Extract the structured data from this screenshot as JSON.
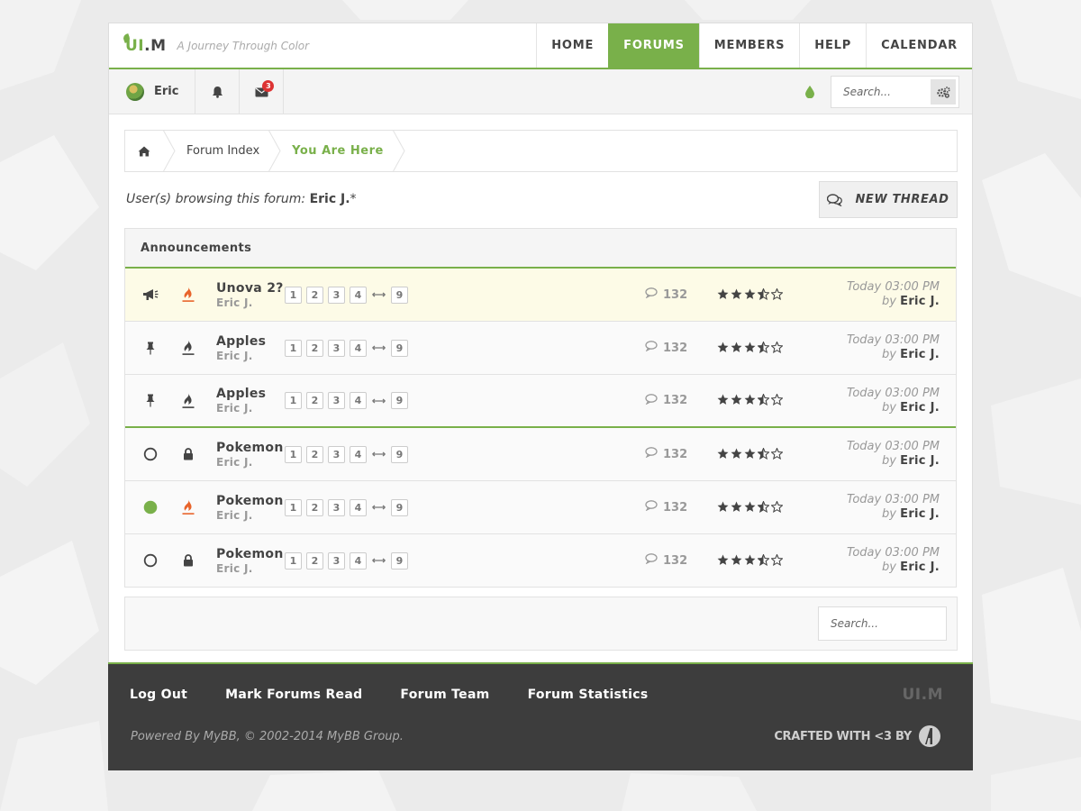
{
  "brand": {
    "logo_prefix": "UI",
    "logo_suffix": ".M",
    "tagline": "A Journey Through Color",
    "accent": "#79b04a"
  },
  "nav": [
    {
      "label": "HOME",
      "active": false
    },
    {
      "label": "FORUMS",
      "active": true
    },
    {
      "label": "MEMBERS",
      "active": false
    },
    {
      "label": "HELP",
      "active": false
    },
    {
      "label": "CALENDAR",
      "active": false
    }
  ],
  "userbar": {
    "username": "Eric",
    "message_count": "3",
    "search_placeholder": "Search..."
  },
  "breadcrumb": {
    "items": [
      "Forum Index",
      "You Are Here"
    ]
  },
  "browsing": {
    "prefix": "User(s) browsing this forum:",
    "users": "Eric J.",
    "suffix": "*"
  },
  "new_thread_label": "NEW THREAD",
  "table": {
    "header": "Announcements",
    "threads": [
      {
        "title": "Unova 2?",
        "author": "Eric J.",
        "status": "announcement-icon",
        "type": "hot-fire-icon",
        "pages": [
          "1",
          "2",
          "3",
          "4",
          "9"
        ],
        "replies": "132",
        "rating": 3.5,
        "last_time": "Today 03:00 PM",
        "last_by_prefix": "by",
        "last_by": "Eric J.",
        "highlight": true
      },
      {
        "title": "Apples",
        "author": "Eric J.",
        "status": "pin-icon",
        "type": "fire-icon",
        "pages": [
          "1",
          "2",
          "3",
          "4",
          "9"
        ],
        "replies": "132",
        "rating": 3.5,
        "last_time": "Today 03:00 PM",
        "last_by_prefix": "by",
        "last_by": "Eric J."
      },
      {
        "title": "Apples",
        "author": "Eric J.",
        "status": "pin-icon",
        "type": "fire-icon",
        "pages": [
          "1",
          "2",
          "3",
          "4",
          "9"
        ],
        "replies": "132",
        "rating": 3.5,
        "last_time": "Today 03:00 PM",
        "last_by_prefix": "by",
        "last_by": "Eric J."
      },
      {
        "title": "Pokemon",
        "author": "Eric J.",
        "status": "read-circle-icon",
        "type": "lock-icon",
        "pages": [
          "1",
          "2",
          "3",
          "4",
          "9"
        ],
        "replies": "132",
        "rating": 3.5,
        "last_time": "Today 03:00 PM",
        "last_by_prefix": "by",
        "last_by": "Eric J."
      },
      {
        "title": "Pokemon",
        "author": "Eric J.",
        "status": "unread-circle-icon",
        "type": "hot-fire-icon",
        "pages": [
          "1",
          "2",
          "3",
          "4",
          "9"
        ],
        "replies": "132",
        "rating": 3.5,
        "last_time": "Today 03:00 PM",
        "last_by_prefix": "by",
        "last_by": "Eric J."
      },
      {
        "title": "Pokemon",
        "author": "Eric J.",
        "status": "read-circle-icon",
        "type": "lock-icon",
        "pages": [
          "1",
          "2",
          "3",
          "4",
          "9"
        ],
        "replies": "132",
        "rating": 3.5,
        "last_time": "Today 03:00 PM",
        "last_by_prefix": "by",
        "last_by": "Eric J."
      }
    ]
  },
  "bottom_search_placeholder": "Search...",
  "footer": {
    "links": [
      "Log Out",
      "Mark Forums Read",
      "Forum Team",
      "Forum Statistics"
    ],
    "copyright": "Powered By MyBB, © 2002-2014 MyBB Group.",
    "logo_prefix": "UI",
    "logo_suffix": ".M",
    "crafted": "CRAFTED WITH <3 BY"
  }
}
